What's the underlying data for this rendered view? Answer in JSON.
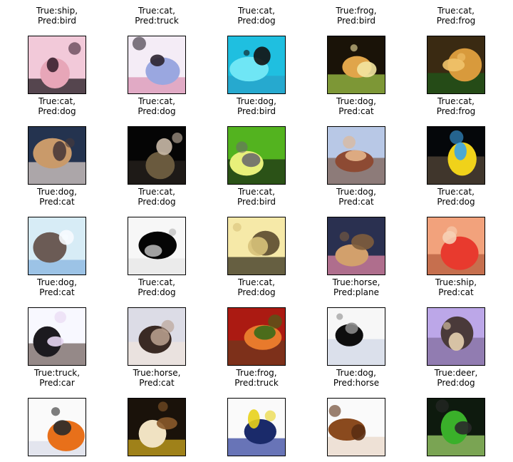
{
  "chart_data": {
    "type": "image-grid",
    "rows": 5,
    "cols": 5,
    "images": [
      {
        "true_label": "ship",
        "pred_label": "bird",
        "line1": "True:ship,",
        "line2": "Pred:bird",
        "colors": [
          "#f2c9d9",
          "#e7a6b8",
          "#3b2230",
          "#120d12"
        ]
      },
      {
        "true_label": "cat",
        "pred_label": "truck",
        "line1": "True:cat,",
        "line2": "Pred:truck",
        "colors": [
          "#f4ecf6",
          "#9aa7e0",
          "#2b2430",
          "#d88fb0"
        ]
      },
      {
        "true_label": "cat",
        "pred_label": "dog",
        "line1": "True:cat,",
        "line2": "Pred:dog",
        "colors": [
          "#1fbfe0",
          "#6fe6f5",
          "#121212",
          "#2aa0c8"
        ]
      },
      {
        "true_label": "frog",
        "pred_label": "bird",
        "line1": "True:frog,",
        "line2": "Pred:bird",
        "colors": [
          "#1a1308",
          "#e0a54a",
          "#f3e5a1",
          "#a8d04a"
        ]
      },
      {
        "true_label": "cat",
        "pred_label": "frog",
        "line1": "True:cat,",
        "line2": "Pred:frog",
        "colors": [
          "#3a2a12",
          "#d89a3c",
          "#f1c36a",
          "#1d5a1a"
        ]
      },
      {
        "true_label": "cat",
        "pred_label": "dog",
        "line1": "True:cat,",
        "line2": "Pred:dog",
        "colors": [
          "#24334f",
          "#c99a6a",
          "#4a3a3a",
          "#e7d7d0"
        ]
      },
      {
        "true_label": "cat",
        "pred_label": "dog",
        "line1": "True:cat,",
        "line2": "Pred:dog",
        "colors": [
          "#050505",
          "#6a5a3e",
          "#c9b9a7",
          "#2a2420"
        ]
      },
      {
        "true_label": "dog",
        "pred_label": "bird",
        "line1": "True:dog,",
        "line2": "Pred:bird",
        "colors": [
          "#53b31f",
          "#e8f07a",
          "#6b6b6b",
          "#1b2a14"
        ]
      },
      {
        "true_label": "dog",
        "pred_label": "cat",
        "line1": "True:dog,",
        "line2": "Pred:cat",
        "colors": [
          "#b8c8e6",
          "#8d4a33",
          "#e5b58a",
          "#7a5a4a"
        ]
      },
      {
        "true_label": "cat",
        "pred_label": "frog",
        "line1": "True:cat,",
        "line2": "Pred:frog",
        "colors": [
          "#05070a",
          "#f0d21a",
          "#3aa3e8",
          "#5a4a3a"
        ]
      },
      {
        "true_label": "dog",
        "pred_label": "cat",
        "line1": "True:dog,",
        "line2": "Pred:cat",
        "colors": [
          "#d7ecf6",
          "#6b5b55",
          "#f7fbff",
          "#83b2e0"
        ]
      },
      {
        "true_label": "cat",
        "pred_label": "dog",
        "line1": "True:cat,",
        "line2": "Pred:dog",
        "colors": [
          "#f7f7f7",
          "#050505",
          "#b1b1b1",
          "#e5e5e5"
        ]
      },
      {
        "true_label": "cat",
        "pred_label": "bird",
        "line1": "True:cat,",
        "line2": "Pred:bird",
        "colors": [
          "#f6e9a8",
          "#6a5a3a",
          "#d8c27a",
          "#2a2316"
        ]
      },
      {
        "true_label": "dog",
        "pred_label": "cat",
        "line1": "True:dog,",
        "line2": "Pred:cat",
        "colors": [
          "#2a3050",
          "#d2a06c",
          "#7e5d3c",
          "#e889a6"
        ]
      },
      {
        "true_label": "cat",
        "pred_label": "dog",
        "line1": "True:cat,",
        "line2": "Pred:dog",
        "colors": [
          "#f2a27c",
          "#e83a2e",
          "#f6d0b6",
          "#b35a3a"
        ]
      },
      {
        "true_label": "dog",
        "pred_label": "cat",
        "line1": "True:dog,",
        "line2": "Pred:cat",
        "colors": [
          "#f8f8ff",
          "#1c1a1f",
          "#e7d6f2",
          "#6b5a55"
        ]
      },
      {
        "true_label": "cat",
        "pred_label": "dog",
        "line1": "True:cat,",
        "line2": "Pred:dog",
        "colors": [
          "#dcdce6",
          "#3a2a24",
          "#b69c8c",
          "#f0e4dc"
        ]
      },
      {
        "true_label": "cat",
        "pred_label": "dog",
        "line1": "True:cat,",
        "line2": "Pred:dog",
        "colors": [
          "#ab1a12",
          "#e87a2c",
          "#3a6a1a",
          "#6a3a1e"
        ]
      },
      {
        "true_label": "horse",
        "pred_label": "plane",
        "line1": "True:horse,",
        "line2": "Pred:plane",
        "colors": [
          "#f7f7f7",
          "#0e0e0e",
          "#8a8a8a",
          "#cfd6e6"
        ]
      },
      {
        "true_label": "ship",
        "pred_label": "cat",
        "line1": "True:ship,",
        "line2": "Pred:cat",
        "colors": [
          "#bca7e8",
          "#4a3a3a",
          "#e7d1b1",
          "#7f6a9a"
        ]
      },
      {
        "true_label": "truck",
        "pred_label": "car",
        "line1": "True:truck,",
        "line2": "Pred:car",
        "colors": [
          "#fafafa",
          "#e8701a",
          "#2a2a2a",
          "#d8dce8"
        ]
      },
      {
        "true_label": "horse",
        "pred_label": "cat",
        "line1": "True:horse,",
        "line2": "Pred:cat",
        "colors": [
          "#1a120a",
          "#f0e2c2",
          "#8a5a2a",
          "#d8b020"
        ]
      },
      {
        "true_label": "frog",
        "pred_label": "truck",
        "line1": "True:frog,",
        "line2": "Pred:truck",
        "colors": [
          "#fafafa",
          "#1a2a6a",
          "#e8d21a",
          "#2a3a9a"
        ]
      },
      {
        "true_label": "dog",
        "pred_label": "horse",
        "line1": "True:dog,",
        "line2": "Pred:horse",
        "colors": [
          "#fafafa",
          "#8a4a1e",
          "#5a2e12",
          "#e8d6c6"
        ]
      },
      {
        "true_label": "deer",
        "pred_label": "dog",
        "line1": "True:deer,",
        "line2": "Pred:dog",
        "colors": [
          "#0e1a0e",
          "#3ab02a",
          "#2a2a2a",
          "#a8e070"
        ]
      }
    ]
  }
}
